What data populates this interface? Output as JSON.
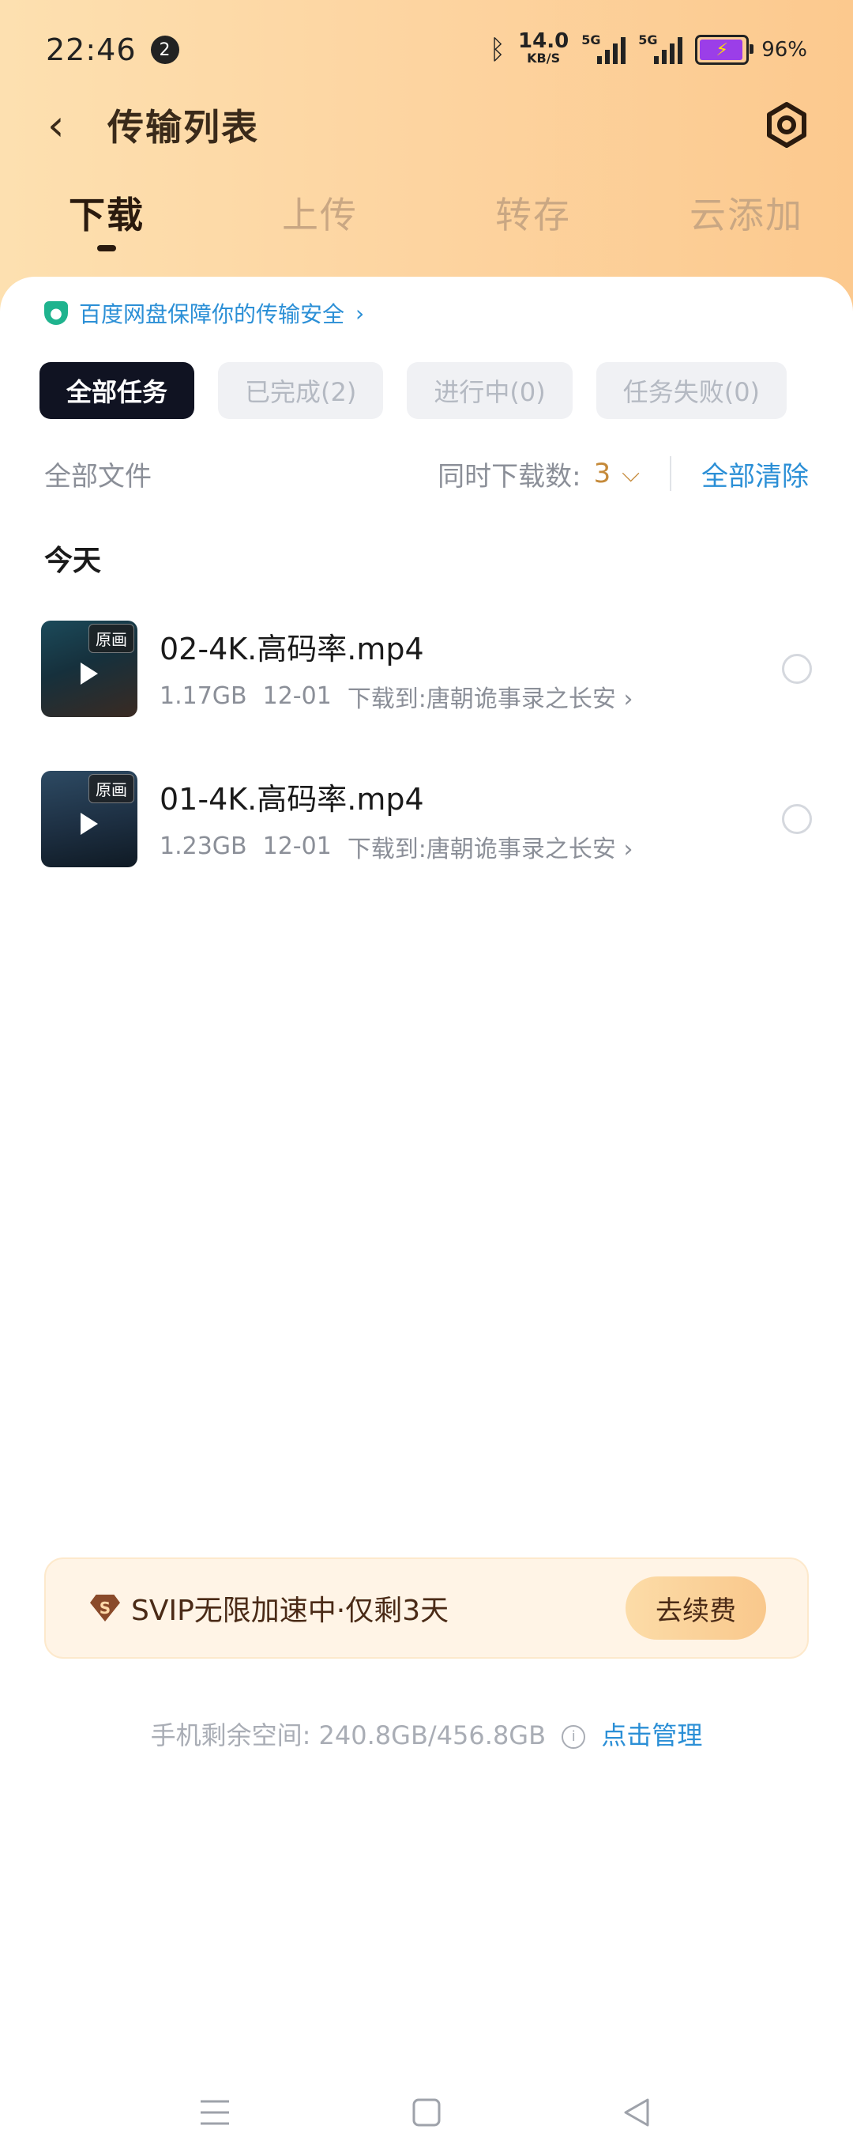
{
  "status_bar": {
    "time": "22:46",
    "notification_count": "2",
    "speed_value": "14.0",
    "speed_unit": "KB/S",
    "signal1_label": "5G",
    "signal2_label": "5G",
    "battery": "96%"
  },
  "nav": {
    "title": "传输列表"
  },
  "tabs": [
    {
      "label": "下载",
      "active": true
    },
    {
      "label": "上传",
      "active": false
    },
    {
      "label": "转存",
      "active": false
    },
    {
      "label": "云添加",
      "active": false
    }
  ],
  "notice": {
    "text": "百度网盘保障你的传输安全"
  },
  "filters": [
    {
      "label": "全部任务",
      "active": true
    },
    {
      "label": "已完成(2)",
      "active": false
    },
    {
      "label": "进行中(0)",
      "active": false
    },
    {
      "label": "任务失败(0)",
      "active": false
    }
  ],
  "options": {
    "all_files": "全部文件",
    "concurrent_label": "同时下载数:",
    "concurrent_value": "3",
    "clear_all": "全部清除"
  },
  "section_title": "今天",
  "files": [
    {
      "badge": "原画",
      "name": "02-4K.高码率.mp4",
      "size": "1.17GB",
      "date": "12-01",
      "destination": "下载到:唐朝诡事录之长安"
    },
    {
      "badge": "原画",
      "name": "01-4K.高码率.mp4",
      "size": "1.23GB",
      "date": "12-01",
      "destination": "下载到:唐朝诡事录之长安"
    }
  ],
  "vip": {
    "badge_letter": "S",
    "text": "SVIP无限加速中·仅剩3天",
    "renew_label": "去续费"
  },
  "storage": {
    "label": "手机剩余空间:",
    "value": "240.8GB/456.8GB",
    "link": "点击管理"
  },
  "colors": {
    "accent_blue": "#2b8fd6",
    "header_gradient_start": "#fde0b0",
    "header_gradient_end": "#fcc98e",
    "active_chip": "#101322"
  }
}
